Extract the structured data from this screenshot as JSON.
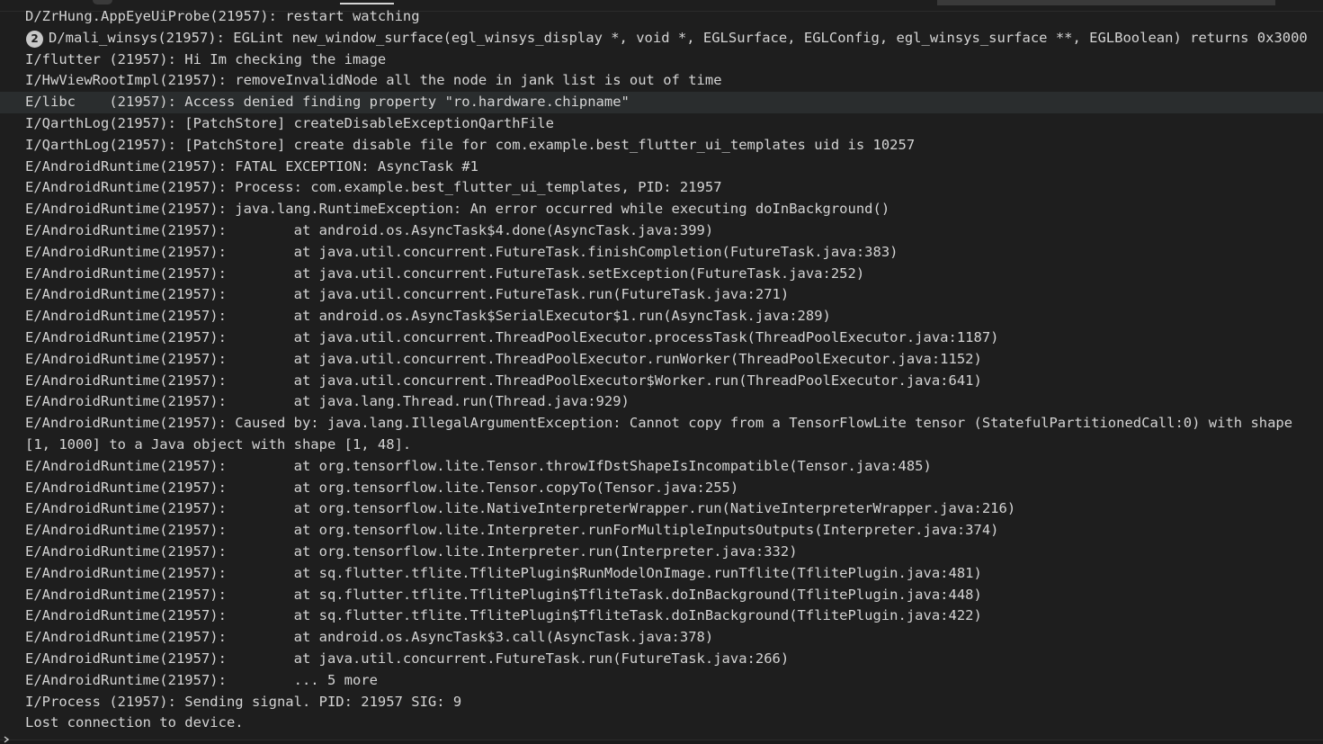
{
  "console": {
    "lines": [
      {
        "text": "D/ZrHung.AppEyeUiProbe(21957): restart watching"
      },
      {
        "badge": "2",
        "text": "D/mali_winsys(21957): EGLint new_window_surface(egl_winsys_display *, void *, EGLSurface, EGLConfig, egl_winsys_surface **, EGLBoolean) returns 0x3000"
      },
      {
        "text": "I/flutter (21957): Hi Im checking the image"
      },
      {
        "text": "I/HwViewRootImpl(21957): removeInvalidNode all the node in jank list is out of time"
      },
      {
        "text": "E/libc    (21957): Access denied finding property \"ro.hardware.chipname\""
      },
      {
        "text": "I/QarthLog(21957): [PatchStore] createDisableExceptionQarthFile"
      },
      {
        "text": "I/QarthLog(21957): [PatchStore] create disable file for com.example.best_flutter_ui_templates uid is 10257"
      },
      {
        "text": "E/AndroidRuntime(21957): FATAL EXCEPTION: AsyncTask #1"
      },
      {
        "text": "E/AndroidRuntime(21957): Process: com.example.best_flutter_ui_templates, PID: 21957"
      },
      {
        "text": "E/AndroidRuntime(21957): java.lang.RuntimeException: An error occurred while executing doInBackground()"
      },
      {
        "text": "E/AndroidRuntime(21957):        at android.os.AsyncTask$4.done(AsyncTask.java:399)"
      },
      {
        "text": "E/AndroidRuntime(21957):        at java.util.concurrent.FutureTask.finishCompletion(FutureTask.java:383)"
      },
      {
        "text": "E/AndroidRuntime(21957):        at java.util.concurrent.FutureTask.setException(FutureTask.java:252)"
      },
      {
        "text": "E/AndroidRuntime(21957):        at java.util.concurrent.FutureTask.run(FutureTask.java:271)"
      },
      {
        "text": "E/AndroidRuntime(21957):        at android.os.AsyncTask$SerialExecutor$1.run(AsyncTask.java:289)"
      },
      {
        "text": "E/AndroidRuntime(21957):        at java.util.concurrent.ThreadPoolExecutor.processTask(ThreadPoolExecutor.java:1187)"
      },
      {
        "text": "E/AndroidRuntime(21957):        at java.util.concurrent.ThreadPoolExecutor.runWorker(ThreadPoolExecutor.java:1152)"
      },
      {
        "text": "E/AndroidRuntime(21957):        at java.util.concurrent.ThreadPoolExecutor$Worker.run(ThreadPoolExecutor.java:641)"
      },
      {
        "text": "E/AndroidRuntime(21957):        at java.lang.Thread.run(Thread.java:929)"
      },
      {
        "text": "E/AndroidRuntime(21957): Caused by: java.lang.IllegalArgumentException: Cannot copy from a TensorFlowLite tensor (StatefulPartitionedCall:0) with shape"
      },
      {
        "text": "[1, 1000] to a Java object with shape [1, 48]."
      },
      {
        "text": "E/AndroidRuntime(21957):        at org.tensorflow.lite.Tensor.throwIfDstShapeIsIncompatible(Tensor.java:485)"
      },
      {
        "text": "E/AndroidRuntime(21957):        at org.tensorflow.lite.Tensor.copyTo(Tensor.java:255)"
      },
      {
        "text": "E/AndroidRuntime(21957):        at org.tensorflow.lite.NativeInterpreterWrapper.run(NativeInterpreterWrapper.java:216)"
      },
      {
        "text": "E/AndroidRuntime(21957):        at org.tensorflow.lite.Interpreter.runForMultipleInputsOutputs(Interpreter.java:374)"
      },
      {
        "text": "E/AndroidRuntime(21957):        at org.tensorflow.lite.Interpreter.run(Interpreter.java:332)"
      },
      {
        "text": "E/AndroidRuntime(21957):        at sq.flutter.tflite.TflitePlugin$RunModelOnImage.runTflite(TflitePlugin.java:481)"
      },
      {
        "text": "E/AndroidRuntime(21957):        at sq.flutter.tflite.TflitePlugin$TfliteTask.doInBackground(TflitePlugin.java:448)"
      },
      {
        "text": "E/AndroidRuntime(21957):        at sq.flutter.tflite.TflitePlugin$TfliteTask.doInBackground(TflitePlugin.java:422)"
      },
      {
        "text": "E/AndroidRuntime(21957):        at android.os.AsyncTask$3.call(AsyncTask.java:378)"
      },
      {
        "text": "E/AndroidRuntime(21957):        at java.util.concurrent.FutureTask.run(FutureTask.java:266)"
      },
      {
        "text": "E/AndroidRuntime(21957):        ... 5 more"
      },
      {
        "text": "I/Process (21957): Sending signal. PID: 21957 SIG: 9"
      },
      {
        "text": "Lost connection to device."
      }
    ]
  }
}
